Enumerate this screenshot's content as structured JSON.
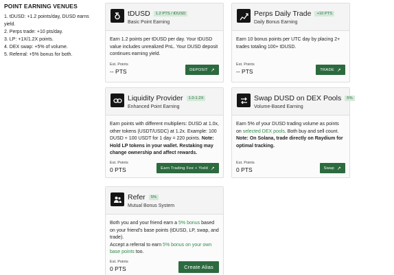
{
  "sidebar": {
    "heading": "POINT EARNING VENUES",
    "lines": [
      "1. tDUSD: +1.2 points/day, DUSD earns",
      "yield.",
      "2. Perps trade: +10 pts/day.",
      "3. LP: +1X/1.2X points.",
      "4. DEX swap: +5% of volume.",
      "5. Referral: +5% bonus for both."
    ]
  },
  "cards": {
    "tdusd": {
      "icon": "tdusd-logo-icon",
      "title": "tDUSD",
      "badge": "1.2 PTS / tDUSD",
      "subtitle": "Basic Point Earning",
      "desc": "Earn 1.2 points per tDUSD per day. Your tDUSD value includes unrealized PnL. Your DUSD deposit continues earning yield.",
      "est_label": "Est. Points",
      "points": "-- PTS",
      "button": "DEPOSIT"
    },
    "perps": {
      "icon": "chart-trend-icon",
      "title": "Perps Daily Trade",
      "badge": "+10 PTS",
      "subtitle": "Daily Bonus Earning",
      "desc": "Earn 10 bonus points per UTC day by placing 2+ trades totaling 100+ tDUSD.",
      "est_label": "Est. Points",
      "points": "-- PTS",
      "button": "TRADE"
    },
    "lp": {
      "icon": "chain-link-icon",
      "title": "Liquidity Provider",
      "badge": "1.0-1.2X",
      "subtitle": "Enhanced Point Earning",
      "desc": "Earn points with different multipliers: DUSD at 1.0x, other tokens (USDT/USDC) at 1.2x. Example: 100 DUSD + 100 USDT for 1 day = 220 points.",
      "note": "Note: Hold LP tokens in your wallet. Restaking may change ownership and affect rewards.",
      "est_label": "Est. Points",
      "points": "0 PTS",
      "button": "Earn Trading Fee + Yield"
    },
    "swap": {
      "icon": "swap-icon",
      "title": "Swap DUSD on DEX Pools",
      "badge": "5%",
      "subtitle": "Volume-Based Earning",
      "desc_a": "Earn 5% of your DUSD trading volume as points on",
      "desc_link": "selected DEX pools",
      "desc_b": ". Both buy and sell count.",
      "note": "Note: On Solana, trade directly on Raydium for optimal tracking.",
      "est_label": "Est. Points",
      "points": "0 PTS",
      "button": "Swap"
    },
    "refer": {
      "icon": "referral-people-icon",
      "title": "Refer",
      "badge": "5%",
      "subtitle": "Mutual Bonus System",
      "desc_a": "Both you and your friend earn a",
      "desc_link": "5% bonus",
      "desc_b": "based on your friend's base points (tDUSD, LP, swap, and trade).",
      "desc_c": "Accept a referral to earn",
      "desc_link2": "5% bonus on your own base points",
      "desc_d": "too.",
      "est_label": "Est. Points",
      "points": "0 PTS",
      "button": "Create Alias"
    }
  },
  "colors": {
    "accent_green": "#2c6a3f",
    "badge_bg": "#d4ead9",
    "badge_text": "#2f6b45",
    "link_green": "#2f8a4a"
  }
}
